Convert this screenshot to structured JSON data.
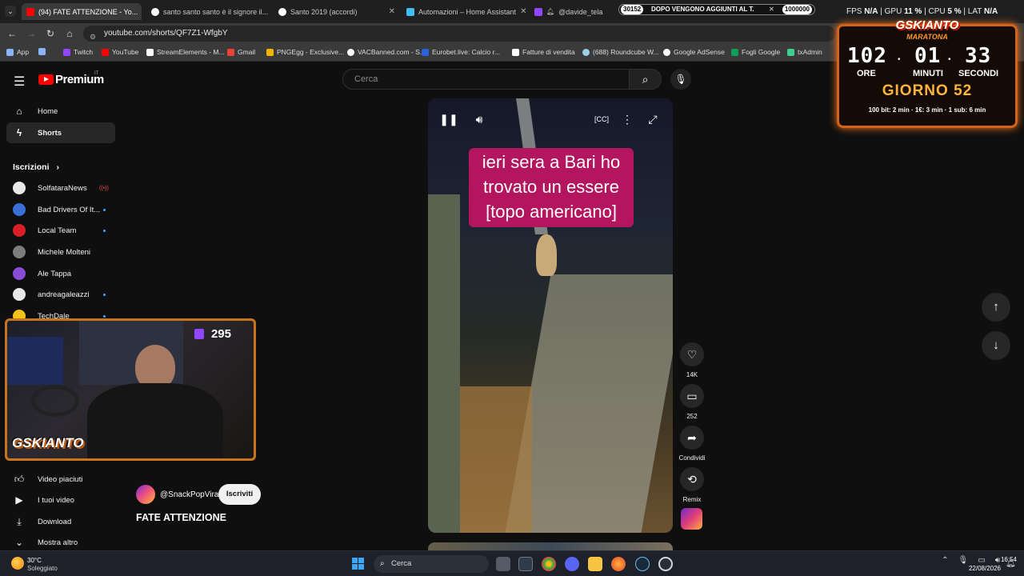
{
  "browser": {
    "tabs": [
      {
        "title": "(94) FATE ATTENZIONE - Yo...",
        "active": true,
        "favicon_color": "#ff0000"
      },
      {
        "title": "santo santo santo è il signore il...",
        "active": false,
        "favicon_color": "#ffffff"
      },
      {
        "title": "Santo 2019 (accordi)",
        "active": false,
        "favicon_color": "#ffffff"
      },
      {
        "title": "Automazioni – Home Assistant",
        "active": false,
        "favicon_color": "#41bdf5"
      },
      {
        "title": "@davide_tela",
        "active": false,
        "favicon_color": "#9146ff"
      }
    ],
    "url": "youtube.com/shorts/QF7Z1-WfgbY",
    "bookmarks": [
      {
        "label": "App",
        "color": "#8ab4f8"
      },
      {
        "label": "",
        "color": "#8ab4f8"
      },
      {
        "label": "Twitch",
        "color": "#9146ff"
      },
      {
        "label": "YouTube",
        "color": "#ff0000"
      },
      {
        "label": "StreamElements - M...",
        "color": "#ffffff"
      },
      {
        "label": "Gmail",
        "color": "#ea4335"
      },
      {
        "label": "PNGEgg - Exclusive...",
        "color": "#f4b400"
      },
      {
        "label": "VACBanned.com - S...",
        "color": "#ffffff"
      },
      {
        "label": "Eurobet.live: Calcio r...",
        "color": "#2a62d8"
      },
      {
        "label": "Fatture di vendita",
        "color": "#ffffff"
      },
      {
        "label": "(688) Roundcube W...",
        "color": "#9ecfe8"
      },
      {
        "label": "Google AdSense",
        "color": "#ffffff"
      },
      {
        "label": "Fogli Google",
        "color": "#0f9d58"
      },
      {
        "label": "txAdmin",
        "color": "#3ecf8e"
      }
    ]
  },
  "stream_overlay": {
    "banner_left": "30152",
    "banner_text": "DOPO VENGONO AGGIUNTI AL T.",
    "banner_right": "1000000",
    "stats": [
      {
        "label": "FPS",
        "value": "N/A"
      },
      {
        "label": "GPU",
        "value": "11 %"
      },
      {
        "label": "CPU",
        "value": "5 %"
      },
      {
        "label": "LAT",
        "value": "N/A"
      }
    ],
    "timer": {
      "title": "GSKIANTO",
      "subtitle": "MARATONA",
      "hours": "102",
      "minutes": "01",
      "seconds": "33",
      "hours_label": "ORE",
      "minutes_label": "MINUTI",
      "seconds_label": "SECONDI",
      "day": "GIORNO 52",
      "rules": "100 bit: 2 min · 1€: 3 min · 1 sub: 6 min"
    },
    "webcam": {
      "viewer_count": "295",
      "logo": "GSKIANTO"
    }
  },
  "youtube": {
    "logo_text": "Premium",
    "logo_country": "IT",
    "search_placeholder": "Cerca",
    "sidebar": {
      "main": [
        {
          "label": "Home",
          "icon": "home-icon",
          "glyph": "⌂",
          "active": false
        },
        {
          "label": "Shorts",
          "icon": "shorts-icon",
          "glyph": "ϟ",
          "active": true
        }
      ],
      "subscriptions_title": "Iscrizioni",
      "subscriptions": [
        {
          "name": "SolfataraNews",
          "color": "#e8e8e8",
          "indicator": "live"
        },
        {
          "name": "Bad Drivers Of It...",
          "color": "#3b6fd8",
          "indicator": "dot"
        },
        {
          "name": "Local Team",
          "color": "#d81f26",
          "indicator": "dot"
        },
        {
          "name": "Michele Molteni",
          "color": "#7d7d7d",
          "indicator": "none"
        },
        {
          "name": "Ale Tappa",
          "color": "#8a4bd8",
          "indicator": "none"
        },
        {
          "name": "andreagaleazzi",
          "color": "#e8e8e8",
          "indicator": "dot"
        },
        {
          "name": "TechDale",
          "color": "#f0c419",
          "indicator": "dot"
        }
      ],
      "you": [
        {
          "label": "Video piaciuti",
          "icon": "thumb-up-icon",
          "glyph": "👍︎"
        },
        {
          "label": "I tuoi video",
          "icon": "play-square-icon",
          "glyph": "▶"
        },
        {
          "label": "Download",
          "icon": "download-icon",
          "glyph": "⤓"
        },
        {
          "label": "Mostra altro",
          "icon": "chevron-down-icon",
          "glyph": "⌄"
        }
      ]
    },
    "short": {
      "caption": "ieri sera a Bari ho trovato un essere [topo americano]",
      "channel": "@SnackPopViral",
      "subscribe_label": "Iscriviti",
      "title": "FATE ATTENZIONE",
      "likes": "14K",
      "comments": "252",
      "share_label": "Condividi",
      "remix_label": "Remix"
    }
  },
  "taskbar": {
    "weather_temp": "30°C",
    "weather_desc": "Soleggiato",
    "search_label": "Cerca",
    "time": "16:54",
    "date": "22/08/2026"
  }
}
